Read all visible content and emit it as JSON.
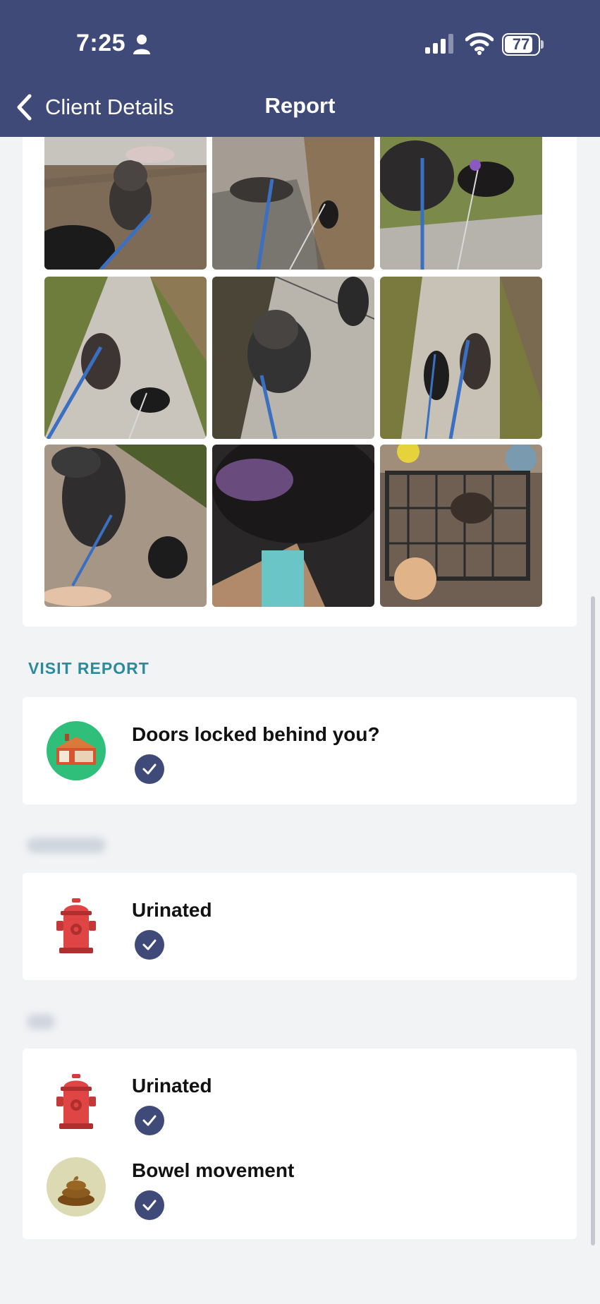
{
  "status_bar": {
    "time": "7:25",
    "battery": "77",
    "battery_level": 0.77
  },
  "nav": {
    "back_label": "Client Details",
    "title": "Report"
  },
  "photos": [
    {
      "name": "photo-1"
    },
    {
      "name": "photo-2"
    },
    {
      "name": "photo-3"
    },
    {
      "name": "photo-4"
    },
    {
      "name": "photo-5"
    },
    {
      "name": "photo-6"
    },
    {
      "name": "photo-7"
    },
    {
      "name": "photo-8"
    },
    {
      "name": "photo-9"
    }
  ],
  "visit_report": {
    "section_label": "VISIT REPORT",
    "items": [
      {
        "label": "Doors locked behind you?",
        "checked": true,
        "icon": "house-icon"
      }
    ]
  },
  "pet_1": {
    "items": [
      {
        "label": "Urinated",
        "checked": true,
        "icon": "fire-hydrant-icon"
      }
    ]
  },
  "pet_2": {
    "items": [
      {
        "label": "Urinated",
        "checked": true,
        "icon": "fire-hydrant-icon"
      },
      {
        "label": "Bowel movement",
        "checked": true,
        "icon": "poop-icon"
      }
    ]
  },
  "colors": {
    "header": "#3f4a78",
    "accent": "#2b8a9b",
    "check": "#3f4a78"
  }
}
